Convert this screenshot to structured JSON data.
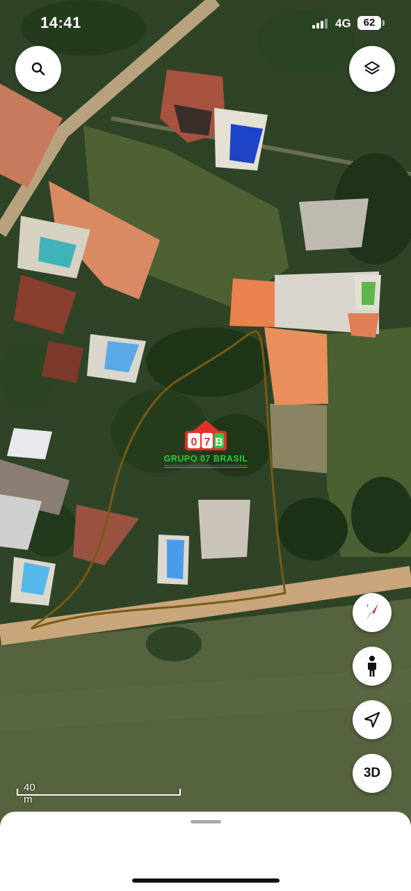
{
  "status_bar": {
    "time": "14:41",
    "network": "4G",
    "battery": "62"
  },
  "map": {
    "type": "satellite",
    "scale_label": "40 m",
    "watermark": {
      "logo_letters": "07B",
      "brand": "GRUPO 07 BRASIL"
    },
    "boundary_color": "#7a5a12"
  },
  "controls": {
    "search": {
      "icon": "search-icon"
    },
    "layers": {
      "icon": "layers-icon"
    },
    "compass": {
      "icon": "compass-icon"
    },
    "street_view": {
      "icon": "person-icon"
    },
    "locate": {
      "icon": "location-arrow-icon"
    },
    "view_3d": {
      "label": "3D"
    }
  },
  "colors": {
    "accent_red": "#e0312b",
    "brand_green": "#2ecc40",
    "sheet_bg": "#ffffff"
  }
}
